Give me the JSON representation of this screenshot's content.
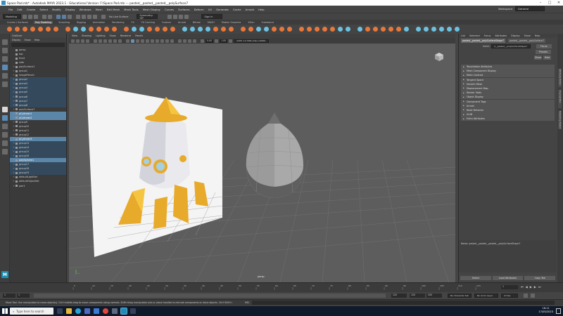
{
  "title_bar": {
    "title": "Space Pod.mb* - Autodesk MAYA 2023.1 - Educational Version: F:\\Space Pod.mb  ---  pasted__pasted__pasted__polySurface7",
    "minimize": "–",
    "maximize": "□",
    "close": "✕"
  },
  "menu": {
    "items": [
      "File",
      "Edit",
      "Create",
      "Select",
      "Modify",
      "Display",
      "Windows",
      "Mesh",
      "Edit Mesh",
      "Mesh Tools",
      "Mesh Display",
      "Curves",
      "Surfaces",
      "Deform",
      "UV",
      "Generate",
      "Cache",
      "Arnold",
      "Help"
    ],
    "workspace_label": "Workspace:",
    "workspace_value": "General"
  },
  "status_line": {
    "mode": "Modeling",
    "no_live_surface": "No Live Surface",
    "symmetry": "Symmetry: Off",
    "sign_in": "Sign In"
  },
  "shelf": {
    "tabs": [
      "Curves / Surfaces",
      "Poly Modeling",
      "Sculpting",
      "Rigging",
      "Animation",
      "Rendering",
      "FX",
      "FX Caching",
      "Custom",
      "Arnold",
      "Bifrost",
      "MASH",
      "Motion Graphics",
      "XGen",
      "Substance"
    ],
    "active_tab": "Poly Modeling",
    "icon_colors": [
      "#e8773a",
      "#e8773a",
      "#e8773a",
      "#e8773a",
      "#e8773a",
      "#e8773a",
      "#e8773a",
      "#e8773a",
      "#6cc1e0",
      "#6cc1e0",
      "#e8773a",
      "#e8773a",
      "#e8773a",
      "#e8773a",
      "#e8773a",
      "#6cc1e0",
      "#6cc1e0",
      "#e8773a",
      "#e8773a",
      "#e8773a",
      "#e8773a",
      "#6cc1e0",
      "#6cc1e0",
      "#6cc1e0",
      "#6cc1e0",
      "#e8773a",
      "#e8773a",
      "#e8773a",
      "#e8773a",
      "#e8773a",
      "#6cc1e0",
      "#6cc1e0",
      "#e8773a",
      "#e8773a",
      "#e8773a",
      "#e8773a",
      "#e8773a",
      "#e8773a",
      "#e8773a",
      "#e8773a",
      "#6cc1e0",
      "#6cc1e0",
      "#6cc1e0",
      "#e8773a",
      "#e8773a",
      "#e8773a",
      "#e8773a",
      "#e8773a",
      "#6cc1e0",
      "#6cc1e0",
      "#6cc1e0",
      "#6cc1e0",
      "#6cc1e0",
      "#6cc1e0",
      "#6cc1e0"
    ]
  },
  "outliner": {
    "title": "Outliner",
    "menu": [
      "Display",
      "Show",
      "Help"
    ],
    "items": [
      {
        "label": "persp",
        "state": "normal"
      },
      {
        "label": "top",
        "state": "normal"
      },
      {
        "label": "front",
        "state": "normal"
      },
      {
        "label": "side",
        "state": "normal"
      },
      {
        "label": "polySurface1",
        "state": "normal"
      },
      {
        "label": "group1",
        "state": "normal"
      },
      {
        "label": "imagePlane1",
        "state": "normal"
      },
      {
        "label": "group2",
        "state": "dim"
      },
      {
        "label": "group3",
        "state": "dim"
      },
      {
        "label": "group4",
        "state": "dim"
      },
      {
        "label": "group5",
        "state": "dim"
      },
      {
        "label": "group6",
        "state": "dim"
      },
      {
        "label": "group7",
        "state": "dim"
      },
      {
        "label": "group8",
        "state": "dim"
      },
      {
        "label": "polySurface7",
        "state": "normal"
      },
      {
        "label": "pCylinder1",
        "state": "sel"
      },
      {
        "label": "pCylinder2",
        "state": "sel"
      },
      {
        "label": "group9",
        "state": "normal"
      },
      {
        "label": "group10",
        "state": "normal"
      },
      {
        "label": "group11",
        "state": "normal"
      },
      {
        "label": "group12",
        "state": "normal"
      },
      {
        "label": "pCylinder3",
        "state": "sel"
      },
      {
        "label": "group13",
        "state": "dim"
      },
      {
        "label": "group14",
        "state": "dim"
      },
      {
        "label": "group15",
        "state": "dim"
      },
      {
        "label": "group16",
        "state": "dim"
      },
      {
        "label": "polySphere1",
        "state": "sel"
      },
      {
        "label": "group17",
        "state": "dim"
      },
      {
        "label": "group18",
        "state": "dim"
      },
      {
        "label": "group19",
        "state": "dim"
      },
      {
        "label": "defaultLightSet",
        "state": "normal"
      },
      {
        "label": "defaultObjectSet",
        "state": "normal"
      },
      {
        "label": "pair1",
        "state": "normal"
      }
    ]
  },
  "viewport": {
    "menu": [
      "View",
      "Shading",
      "Lighting",
      "Show",
      "Renderer",
      "Panels"
    ],
    "gamma_value": "0.00",
    "exposure_value": "1.00",
    "color_space": "ACES 1.0 SDR-video (sRGB)",
    "camera_label": "persp"
  },
  "attribute_editor": {
    "menu": [
      "List",
      "Selected",
      "Focus",
      "Attributes",
      "Display",
      "Show",
      "Help"
    ],
    "tabs": [
      "pasted__pasted__polySurfaceShape7",
      "pasted__pasted__polySurface7"
    ],
    "active_tab": "pasted__pasted__polySurfaceShape7",
    "mesh_label": "mesh:",
    "mesh_value": "d__pasted__polySurfaceShape7",
    "focus_button": "Focus",
    "presets_button": "Presets",
    "show_button": "Show",
    "hide_button": "Hide",
    "sections": [
      "Tessellation Attributes",
      "Mesh Component Display",
      "Mesh Controls",
      "Tangent Space",
      "Smooth Mesh",
      "Displacement Map",
      "Render Stats",
      "Object Display",
      "Component Tags",
      "Arnold",
      "Node Behavior",
      "UUID",
      "Extra Attributes"
    ],
    "notes_label": "Notes:  pasted__pasted__pasted__polySurfaceShape7",
    "select_button": "Select",
    "load_attributes_button": "Load Attributes",
    "copy_tab_button": "Copy Tab"
  },
  "side_tabs": [
    "Attribute Editor",
    "Channel Box",
    "Modelling Toolkit"
  ],
  "time_slider": {
    "ticks": [
      "5",
      "10",
      "15",
      "20",
      "25",
      "30",
      "35",
      "40",
      "45",
      "50",
      "55",
      "60",
      "65",
      "70",
      "75",
      "80",
      "85",
      "90",
      "95",
      "100",
      "105",
      "110",
      "115"
    ],
    "current_frame": "1",
    "range_start": "1",
    "range_end": "120",
    "playback_start": "1",
    "playback_end": "120",
    "anim_end": "200",
    "character_set": "No Character Set",
    "anim_layer": "No Anim Layer",
    "fps": "24 fps"
  },
  "command_line": {
    "help_text": "Move Tool: Use manipulator to move object(s). Ctrl+middle-drag to move components along normals. Shift+drag manipulator axis or plane handles to extrude components or clone objects. Ctrl+Shift+drag to constrain movement to a co",
    "mel_label": "MEL"
  },
  "taskbar": {
    "search_placeholder": "Type here to search",
    "time": "16:11",
    "date": "17/05/2023"
  }
}
